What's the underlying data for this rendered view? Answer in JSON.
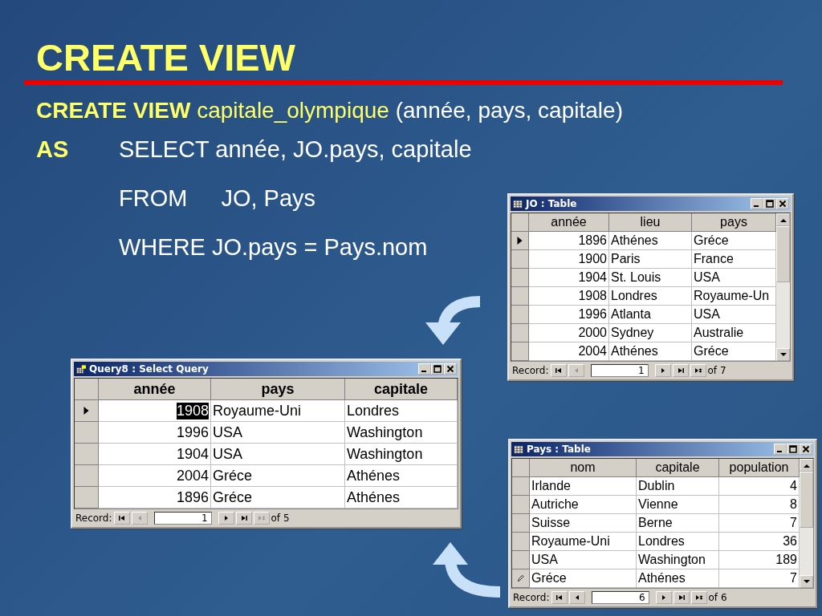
{
  "title": "CREATE VIEW",
  "statement": {
    "keyword": "CREATE VIEW",
    "view_name": "capitale_olympique",
    "columns": "(année, pays, capitale)"
  },
  "query_lines": [
    {
      "label": "AS",
      "parts": [
        "SELECT année, JO.pays, capitale"
      ]
    },
    {
      "parts": [
        "FROM",
        "JO, Pays"
      ]
    },
    {
      "parts": [
        "WHERE JO.pays = Pays.nom"
      ]
    }
  ],
  "windows": [
    {
      "kind": "table",
      "title": "JO : Table",
      "columns": [
        {
          "label": "année",
          "numeric": true
        },
        {
          "label": "lieu",
          "numeric": false
        },
        {
          "label": "pays",
          "numeric": false
        }
      ],
      "rows": [
        {
          "current": true,
          "editing": false,
          "selected": false,
          "cells": [
            "1896",
            "Athénes",
            "Gréce"
          ]
        },
        {
          "current": false,
          "editing": false,
          "selected": false,
          "cells": [
            "1900",
            "Paris",
            "France"
          ]
        },
        {
          "current": false,
          "editing": false,
          "selected": false,
          "cells": [
            "1904",
            "St. Louis",
            "USA"
          ]
        },
        {
          "current": false,
          "editing": false,
          "selected": false,
          "cells": [
            "1908",
            "Londres",
            "Royaume-Un"
          ]
        },
        {
          "current": false,
          "editing": false,
          "selected": false,
          "cells": [
            "1996",
            "Atlanta",
            "USA"
          ]
        },
        {
          "current": false,
          "editing": false,
          "selected": false,
          "cells": [
            "2000",
            "Sydney",
            "Australie"
          ]
        },
        {
          "current": false,
          "editing": false,
          "selected": false,
          "cells": [
            "2004",
            "Athénes",
            "Gréce"
          ]
        }
      ],
      "record": {
        "label": "Record:",
        "current": "1",
        "of": "of 7",
        "prev_enabled": false,
        "new_enabled": true
      }
    },
    {
      "kind": "query",
      "title": "Query8 : Select Query",
      "columns": [
        {
          "label": "année",
          "numeric": true
        },
        {
          "label": "pays",
          "numeric": false
        },
        {
          "label": "capitale",
          "numeric": false
        }
      ],
      "rows": [
        {
          "current": true,
          "editing": false,
          "selected": true,
          "cells": [
            "1908",
            "Royaume-Uni",
            "Londres"
          ]
        },
        {
          "current": false,
          "editing": false,
          "selected": false,
          "cells": [
            "1996",
            "USA",
            "Washington"
          ]
        },
        {
          "current": false,
          "editing": false,
          "selected": false,
          "cells": [
            "1904",
            "USA",
            "Washington"
          ]
        },
        {
          "current": false,
          "editing": false,
          "selected": false,
          "cells": [
            "2004",
            "Gréce",
            "Athénes"
          ]
        },
        {
          "current": false,
          "editing": false,
          "selected": false,
          "cells": [
            "1896",
            "Gréce",
            "Athénes"
          ]
        }
      ],
      "record": {
        "label": "Record:",
        "current": "1",
        "of": "of 5",
        "prev_enabled": false,
        "new_enabled": false
      }
    },
    {
      "kind": "table",
      "title": "Pays : Table",
      "columns": [
        {
          "label": "nom",
          "numeric": false
        },
        {
          "label": "capitale",
          "numeric": false
        },
        {
          "label": "population",
          "numeric": true
        }
      ],
      "rows": [
        {
          "current": false,
          "editing": false,
          "selected": false,
          "cells": [
            "Irlande",
            "Dublin",
            "4"
          ]
        },
        {
          "current": false,
          "editing": false,
          "selected": false,
          "cells": [
            "Autriche",
            "Vienne",
            "8"
          ]
        },
        {
          "current": false,
          "editing": false,
          "selected": false,
          "cells": [
            "Suisse",
            "Berne",
            "7"
          ]
        },
        {
          "current": false,
          "editing": false,
          "selected": false,
          "cells": [
            "Royaume-Uni",
            "Londres",
            "36"
          ]
        },
        {
          "current": false,
          "editing": false,
          "selected": false,
          "cells": [
            "USA",
            "Washington",
            "189"
          ]
        },
        {
          "current": false,
          "editing": true,
          "selected": false,
          "cells": [
            "Gréce",
            "Athénes",
            "7"
          ]
        }
      ],
      "record": {
        "label": "Record:",
        "current": "6",
        "of": "of 6",
        "prev_enabled": true,
        "new_enabled": true
      }
    }
  ]
}
